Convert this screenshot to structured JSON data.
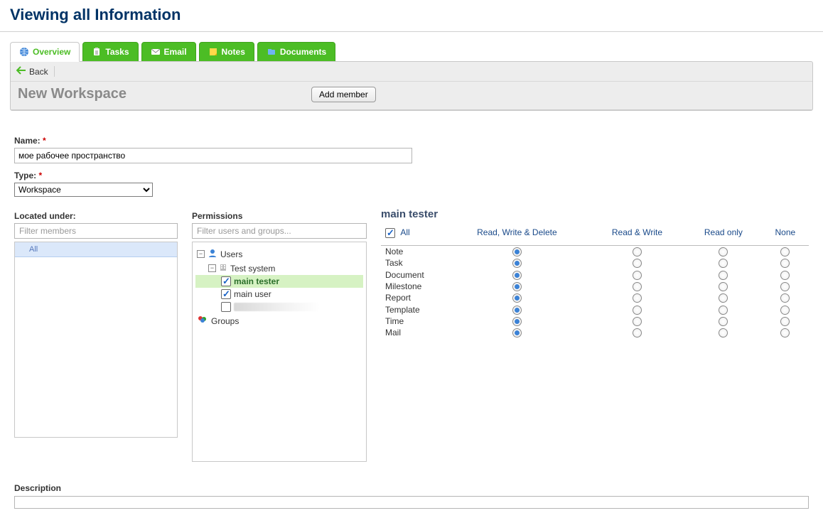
{
  "page_title": "Viewing all Information",
  "tabs": [
    {
      "label": "Overview",
      "active": true
    },
    {
      "label": "Tasks"
    },
    {
      "label": "Email"
    },
    {
      "label": "Notes"
    },
    {
      "label": "Documents"
    }
  ],
  "back_label": "Back",
  "section_title": "New Workspace",
  "add_member_label": "Add member",
  "fields": {
    "name_label": "Name:",
    "name_value": "мое рабочее пространство",
    "type_label": "Type:",
    "type_value": "Workspace",
    "located_label": "Located under:",
    "located_filter_placeholder": "Filter members",
    "located_all": "All",
    "permissions_label": "Permissions",
    "perm_filter_placeholder": "Filter users and groups...",
    "description_label": "Description"
  },
  "perm_tree": {
    "users_label": "Users",
    "test_system_label": "Test system",
    "main_tester_label": "main tester",
    "main_user_label": "main user",
    "groups_label": "Groups"
  },
  "perm_grid": {
    "title": "main tester",
    "all_label": "All",
    "columns": [
      "Read, Write & Delete",
      "Read & Write",
      "Read only",
      "None"
    ],
    "rows": [
      {
        "name": "Note",
        "selected": 0
      },
      {
        "name": "Task",
        "selected": 0
      },
      {
        "name": "Document",
        "selected": 0
      },
      {
        "name": "Milestone",
        "selected": 0
      },
      {
        "name": "Report",
        "selected": 0
      },
      {
        "name": "Template",
        "selected": 0
      },
      {
        "name": "Time",
        "selected": 0
      },
      {
        "name": "Mail",
        "selected": 0
      }
    ]
  }
}
